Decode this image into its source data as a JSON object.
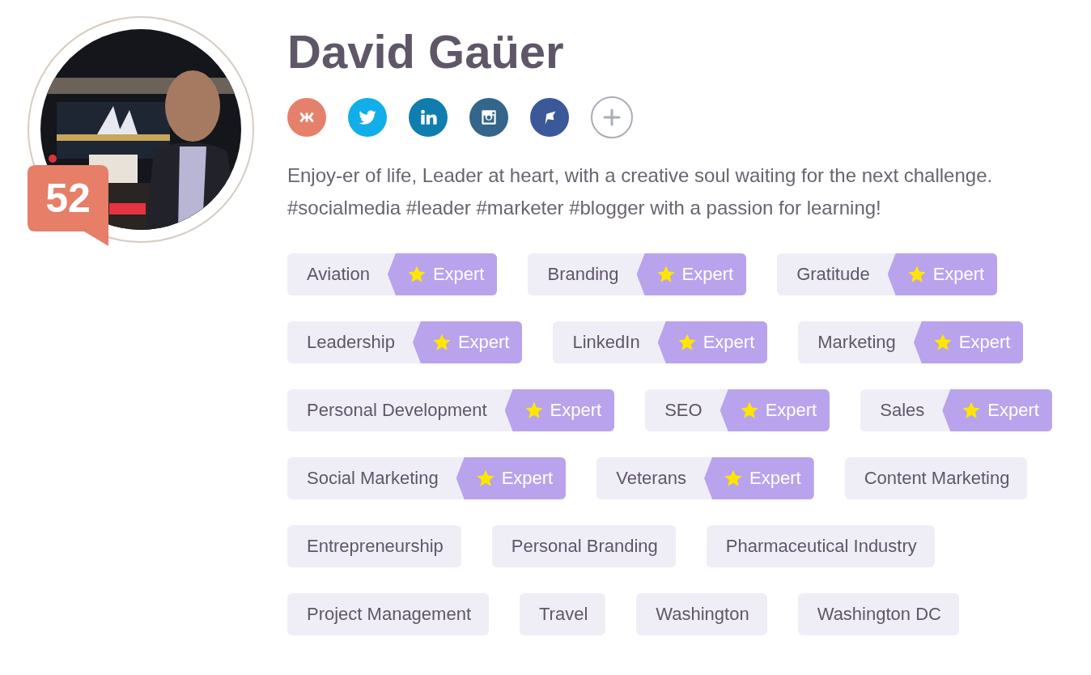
{
  "profile": {
    "name": "David Gaüer",
    "score": "52"
  },
  "social_links": [
    {
      "kind": "klout",
      "color": "#e5806b"
    },
    {
      "kind": "twitter",
      "color": "#12aeea"
    },
    {
      "kind": "linkedin",
      "color": "#0f7dae"
    },
    {
      "kind": "instagram",
      "color": "#34658a"
    },
    {
      "kind": "flag",
      "color": "#3b5898"
    },
    {
      "kind": "add",
      "color": "#a9adb6"
    }
  ],
  "bio": "Enjoy-er of life, Leader at heart, with a creative soul waiting for the next challenge. #socialmedia #leader #marketer #blogger with a passion for learning!",
  "skill_rows": [
    [
      {
        "label": "Aviation",
        "badge": "Expert"
      },
      {
        "label": "Branding",
        "badge": "Expert"
      },
      {
        "label": "Gratitude",
        "badge": "Expert"
      }
    ],
    [
      {
        "label": "Leadership",
        "badge": "Expert"
      },
      {
        "label": "LinkedIn",
        "badge": "Expert"
      },
      {
        "label": "Marketing",
        "badge": "Expert"
      }
    ],
    [
      {
        "label": "Personal Development",
        "badge": "Expert"
      },
      {
        "label": "SEO",
        "badge": "Expert"
      },
      {
        "label": "Sales",
        "badge": "Expert"
      }
    ],
    [
      {
        "label": "Social Marketing",
        "badge": "Expert"
      },
      {
        "label": "Veterans",
        "badge": "Expert"
      },
      {
        "label": "Content Marketing"
      }
    ],
    [
      {
        "label": "Entrepreneurship"
      },
      {
        "label": "Personal Branding"
      },
      {
        "label": "Pharmaceutical Industry"
      }
    ],
    [
      {
        "label": "Project Management"
      },
      {
        "label": "Travel"
      },
      {
        "label": "Washington"
      },
      {
        "label": "Washington DC"
      }
    ]
  ]
}
